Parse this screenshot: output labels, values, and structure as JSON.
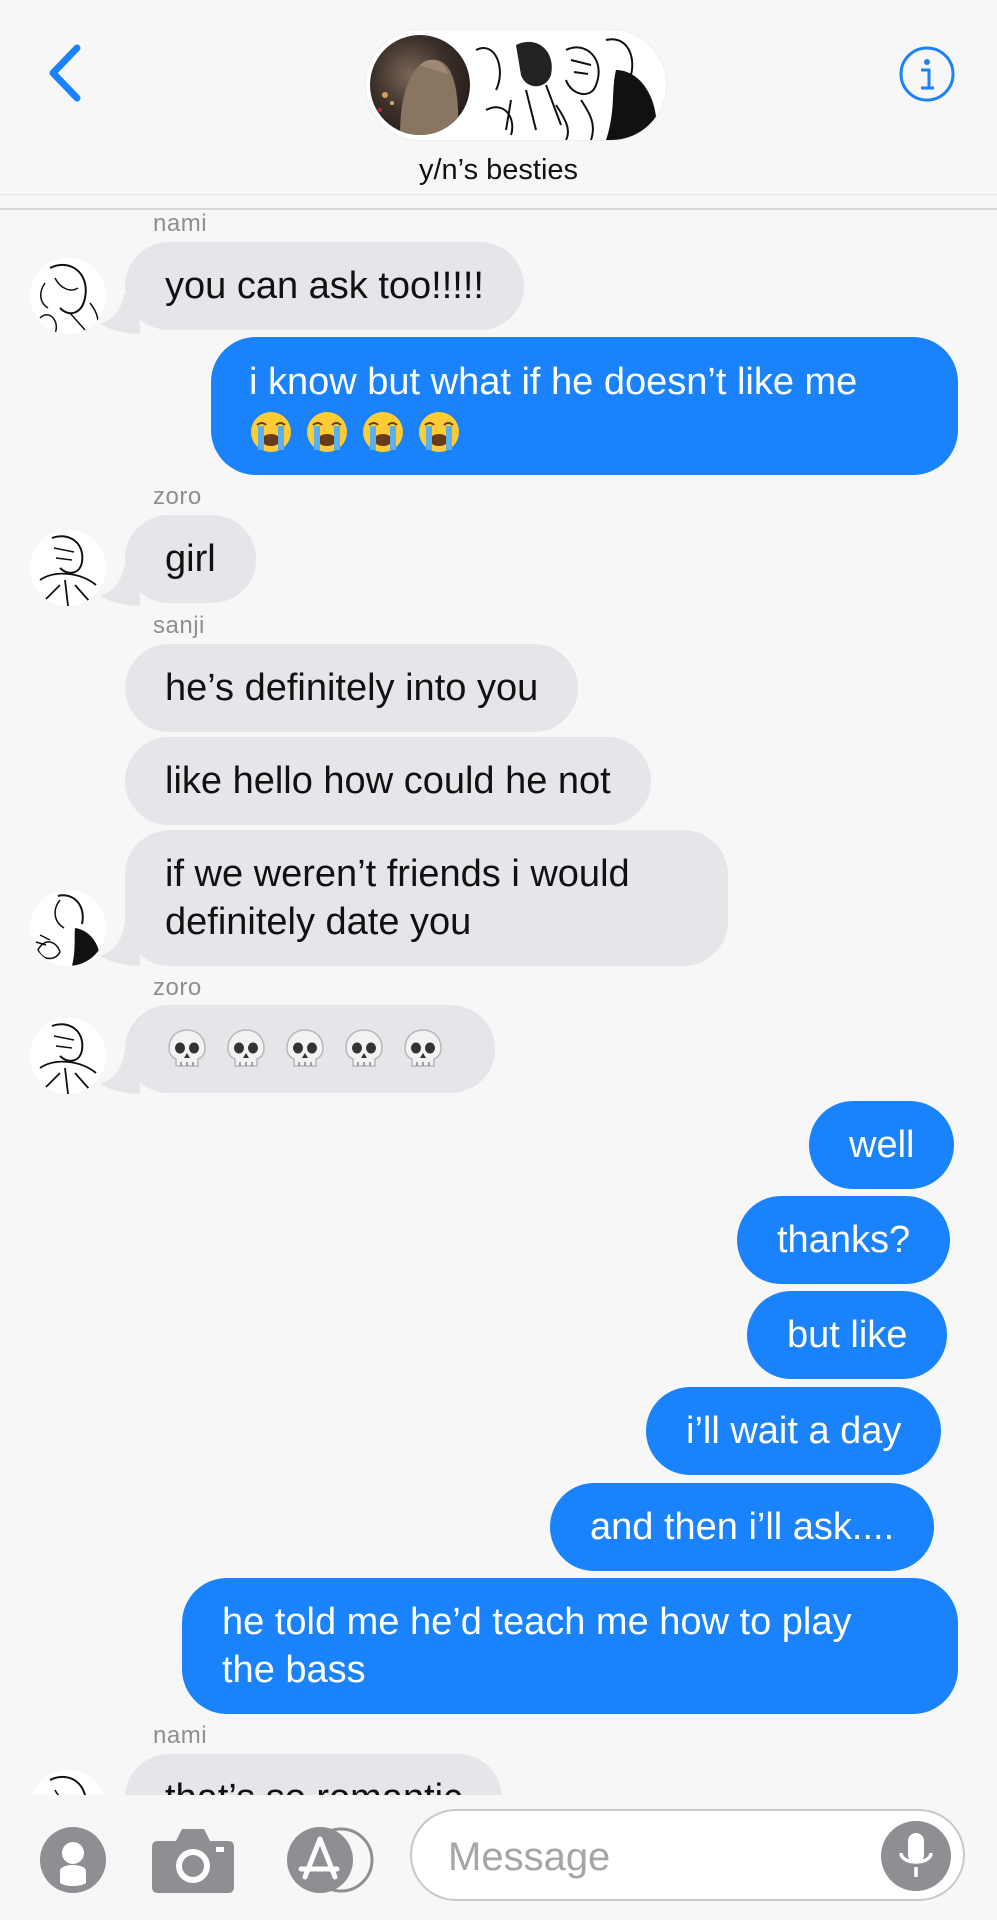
{
  "header": {
    "title": "y/n’s besties",
    "back_icon": "chevron-left-icon",
    "info_icon": "info-icon"
  },
  "messages": [
    {
      "sender": "nami",
      "text": "you can ask too!!!!!",
      "direction": "in"
    },
    {
      "text": "i know but what if he doesn’t like me",
      "emoji": "😭😭😭😭",
      "direction": "out"
    },
    {
      "sender": "zoro",
      "text": "girl",
      "direction": "in"
    },
    {
      "sender": "sanji",
      "text": "he’s definitely into you",
      "direction": "in"
    },
    {
      "text": "like hello how could he not",
      "direction": "in"
    },
    {
      "text_line1": "if we weren’t friends i would",
      "text_line2": "definitely date you",
      "direction": "in"
    },
    {
      "sender": "zoro",
      "emoji": "💀💀💀💀💀",
      "direction": "in"
    },
    {
      "text": "well",
      "direction": "out"
    },
    {
      "text": "thanks?",
      "direction": "out"
    },
    {
      "text": "but like",
      "direction": "out"
    },
    {
      "text": "i’ll wait a day",
      "direction": "out"
    },
    {
      "text": "and then i’ll ask....",
      "direction": "out"
    },
    {
      "text_line1": "he told me he’d teach me how to play",
      "text_line2": "the bass",
      "direction": "out"
    },
    {
      "sender": "nami",
      "text": "that’s so romantic",
      "direction": "in"
    }
  ],
  "input": {
    "placeholder": "Message",
    "icons": [
      "apps-icon",
      "camera-icon",
      "app-store-icon",
      "microphone-icon"
    ]
  },
  "colors": {
    "outgoing": "#1a82fb",
    "incoming": "#e5e5ea",
    "accent": "#1a82fb"
  }
}
